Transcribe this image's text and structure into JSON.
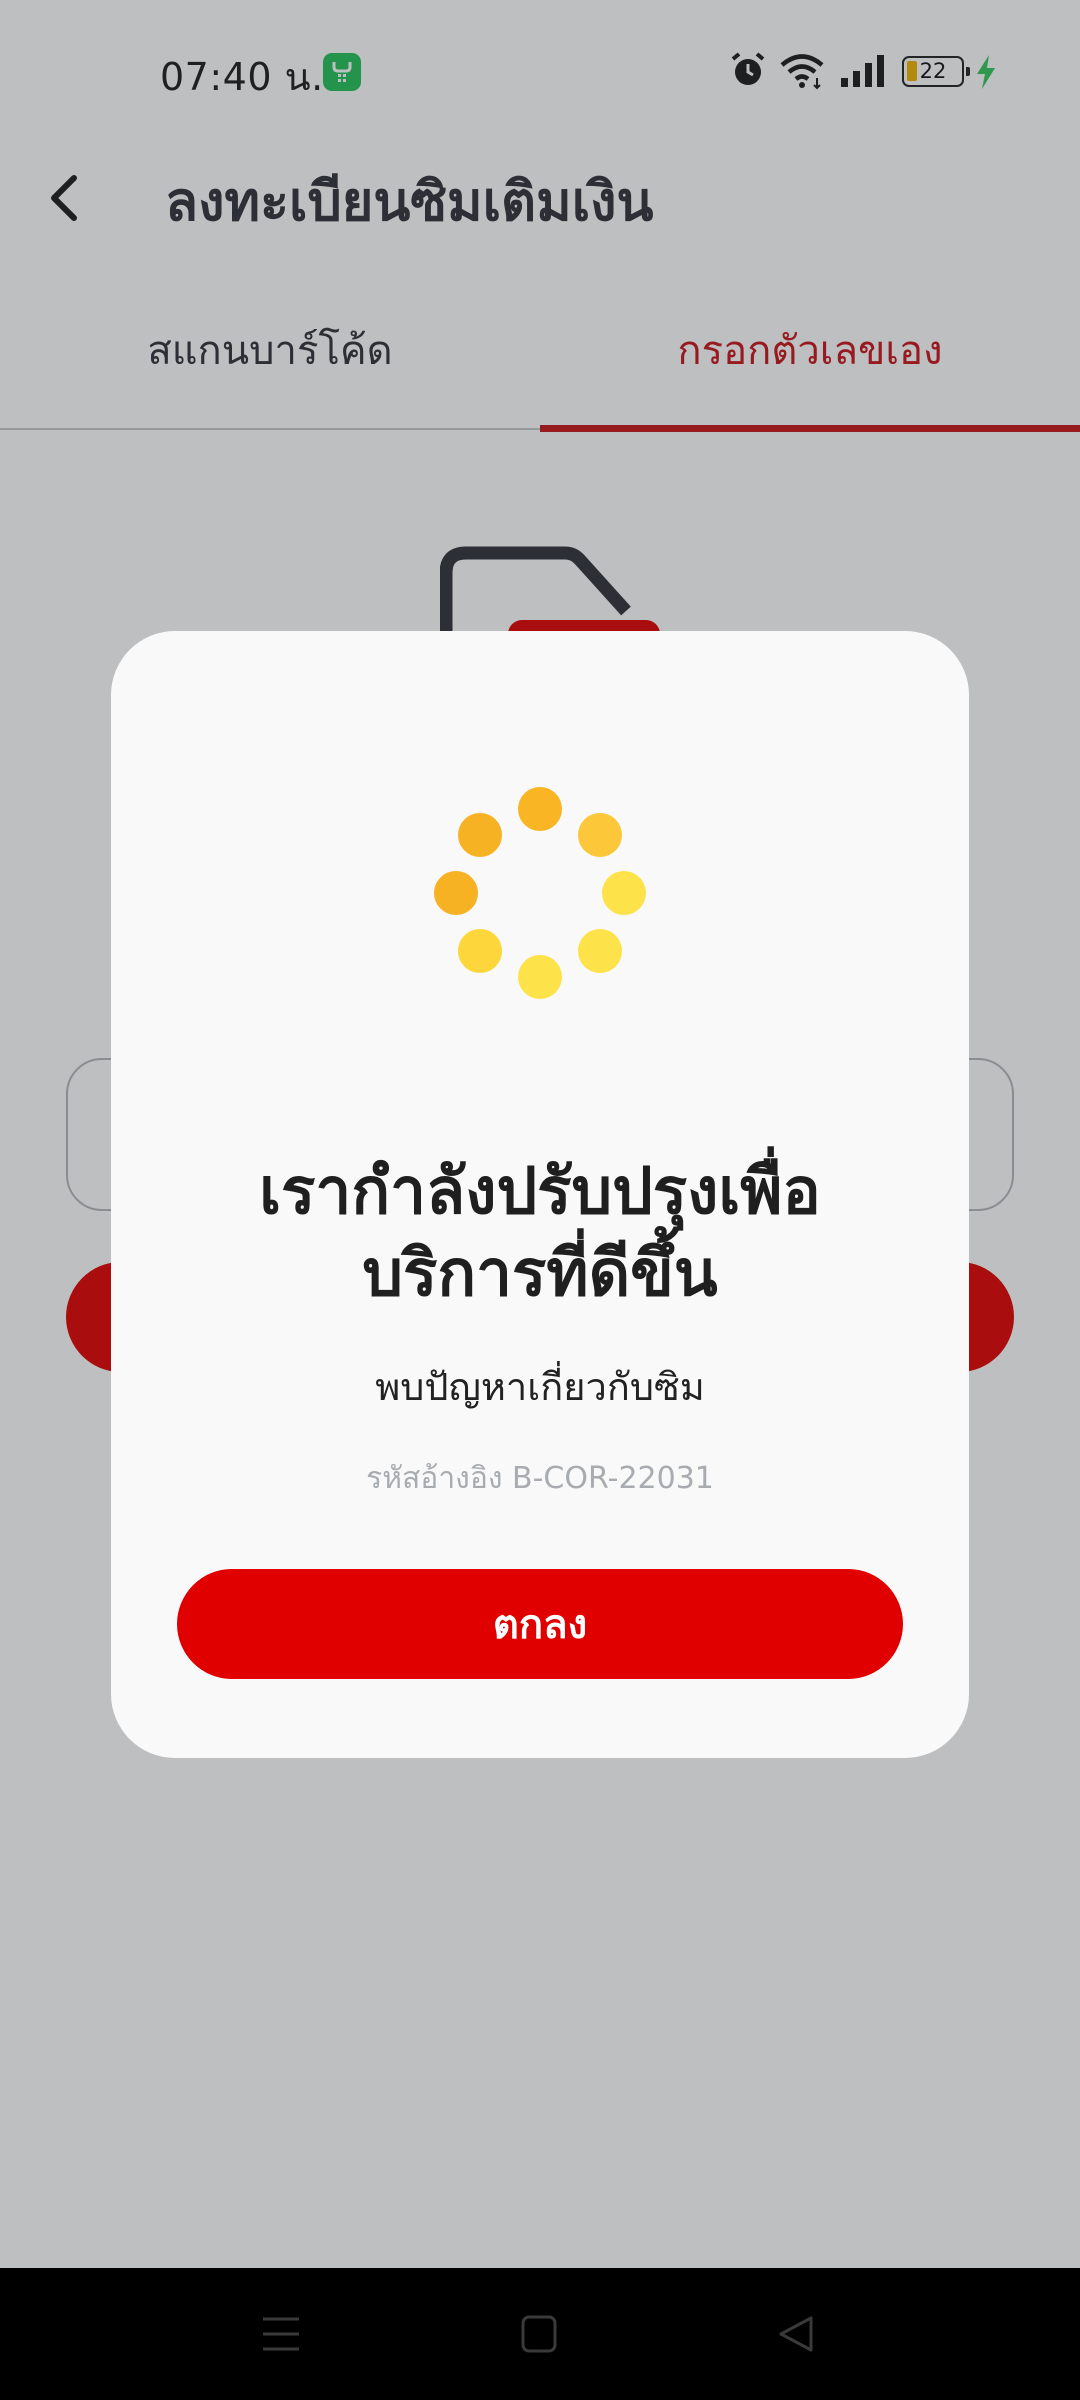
{
  "status_bar": {
    "time": "07:40 น.",
    "battery_level": "22",
    "icons": [
      "app-notification-icon",
      "alarm-icon",
      "wifi-icon",
      "signal-icon",
      "battery-icon",
      "charging-icon"
    ]
  },
  "header": {
    "back_icon": "chevron-left-icon",
    "title": "ลงทะเบียนซิมเติมเงิน"
  },
  "tabs": [
    {
      "label": "สแกนบาร์โค้ด",
      "active": false
    },
    {
      "label": "กรอกตัวเลขเอง",
      "active": true
    }
  ],
  "dialog": {
    "title_line1": "เรากำลังปรับปรุงเพื่อ",
    "title_line2": "บริการที่ดีขึ้น",
    "message": "พบปัญหาเกี่ยวกับซิม",
    "reference": "รหัสอ้างอิง B-COR-22031",
    "ok_label": "ตกลง",
    "spinner_icon": "loading-spinner-icon"
  },
  "nav_bar": {
    "icons": [
      "menu-icon",
      "home-icon",
      "back-triangle-icon"
    ]
  },
  "colors": {
    "accent_red": "#e10000",
    "tab_active": "#c8141c",
    "spinner_dark": "#f7b224",
    "spinner_light": "#fde24a"
  }
}
